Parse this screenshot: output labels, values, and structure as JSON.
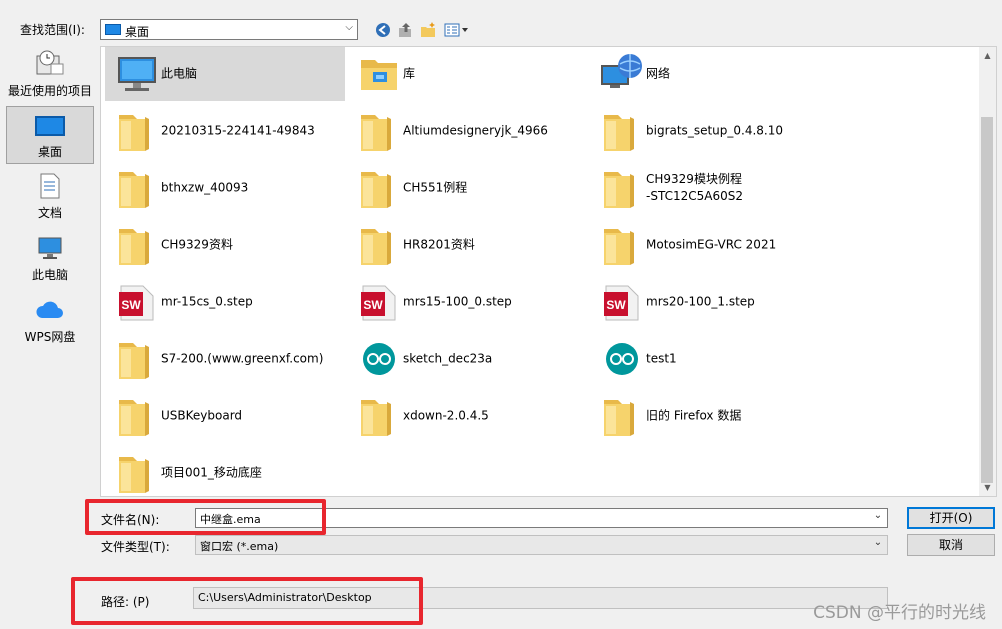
{
  "lookin": {
    "label": "查找范围(I):",
    "value": "桌面"
  },
  "places": [
    {
      "label": "最近使用的项目",
      "icon": "recent-places-icon"
    },
    {
      "label": "桌面",
      "icon": "desktop-icon",
      "selected": true
    },
    {
      "label": "文档",
      "icon": "documents-icon"
    },
    {
      "label": "此电脑",
      "icon": "this-pc-icon"
    },
    {
      "label": "WPS网盘",
      "icon": "cloud-icon"
    }
  ],
  "files": [
    {
      "name": "此电脑",
      "icon": "this-pc-icon",
      "selected": true
    },
    {
      "name": "库",
      "icon": "library-folder-icon"
    },
    {
      "name": "网络",
      "icon": "network-icon"
    },
    {
      "name": "20210315-224141-49843",
      "icon": "folder-icon"
    },
    {
      "name": "Altiumdesigneryjk_4966",
      "icon": "folder-icon"
    },
    {
      "name": "bigrats_setup_0.4.8.10",
      "icon": "folder-icon"
    },
    {
      "name": "bthxzw_40093",
      "icon": "folder-icon"
    },
    {
      "name": "CH551例程",
      "icon": "folder-icon"
    },
    {
      "name": "CH9329模块例程\n-STC12C5A60S2",
      "icon": "folder-icon"
    },
    {
      "name": "CH9329资料",
      "icon": "folder-icon"
    },
    {
      "name": "HR8201资料",
      "icon": "folder-icon"
    },
    {
      "name": "MotosimEG-VRC 2021",
      "icon": "folder-icon"
    },
    {
      "name": "mr-15cs_0.step",
      "icon": "solidworks-file-icon"
    },
    {
      "name": "mrs15-100_0.step",
      "icon": "solidworks-file-icon"
    },
    {
      "name": "mrs20-100_1.step",
      "icon": "solidworks-file-icon"
    },
    {
      "name": "S7-200.(www.greenxf.com)",
      "icon": "folder-icon"
    },
    {
      "name": "sketch_dec23a",
      "icon": "arduino-file-icon"
    },
    {
      "name": "test1",
      "icon": "arduino-file-icon"
    },
    {
      "name": "USBKeyboard",
      "icon": "folder-icon"
    },
    {
      "name": "xdown-2.0.4.5",
      "icon": "folder-icon"
    },
    {
      "name": "旧的 Firefox 数据",
      "icon": "folder-icon"
    },
    {
      "name": "项目001_移动底座",
      "icon": "folder-icon"
    }
  ],
  "filename": {
    "label": "文件名(N):",
    "value": "中继盒.ema"
  },
  "filetype": {
    "label": "文件类型(T):",
    "value": "窗口宏 (*.ema)"
  },
  "buttons": {
    "open": "打开(O)",
    "cancel": "取消"
  },
  "path": {
    "label": "路径: (P)",
    "value": "C:\\Users\\Administrator\\Desktop"
  },
  "watermark": "CSDN @平行的时光线",
  "colors": {
    "highlight_box": "#e8262e",
    "selection": "#d9d9d9",
    "folder": "#f3c95c"
  }
}
